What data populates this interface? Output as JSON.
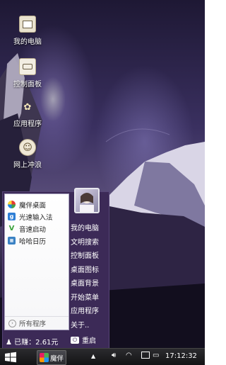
{
  "desktop": {
    "icons": [
      {
        "label": "我的电脑",
        "icon": "computer-icon"
      },
      {
        "label": "控制面板",
        "icon": "control-panel-icon"
      },
      {
        "label": "应用程序",
        "icon": "applications-icon"
      },
      {
        "label": "网上冲浪",
        "icon": "browser-icon"
      }
    ]
  },
  "start_menu": {
    "programs": [
      {
        "label": "魔伴桌面",
        "icon": "flower-icon"
      },
      {
        "label": "光速输入法",
        "icon": "input-method-icon"
      },
      {
        "label": "音速启动",
        "icon": "launcher-icon"
      },
      {
        "label": "哈哈日历",
        "icon": "calendar-icon"
      }
    ],
    "all_programs": "所有程序",
    "right_links": [
      "我的电脑",
      "文明搜索",
      "控制面板",
      "桌面图标",
      "桌面背景",
      "开始菜单",
      "应用程序",
      "关于.."
    ],
    "earned": "已赚：2.61元",
    "restart": "重启"
  },
  "taskbar": {
    "task_label": "魔伴",
    "clock": "17:12:32"
  }
}
